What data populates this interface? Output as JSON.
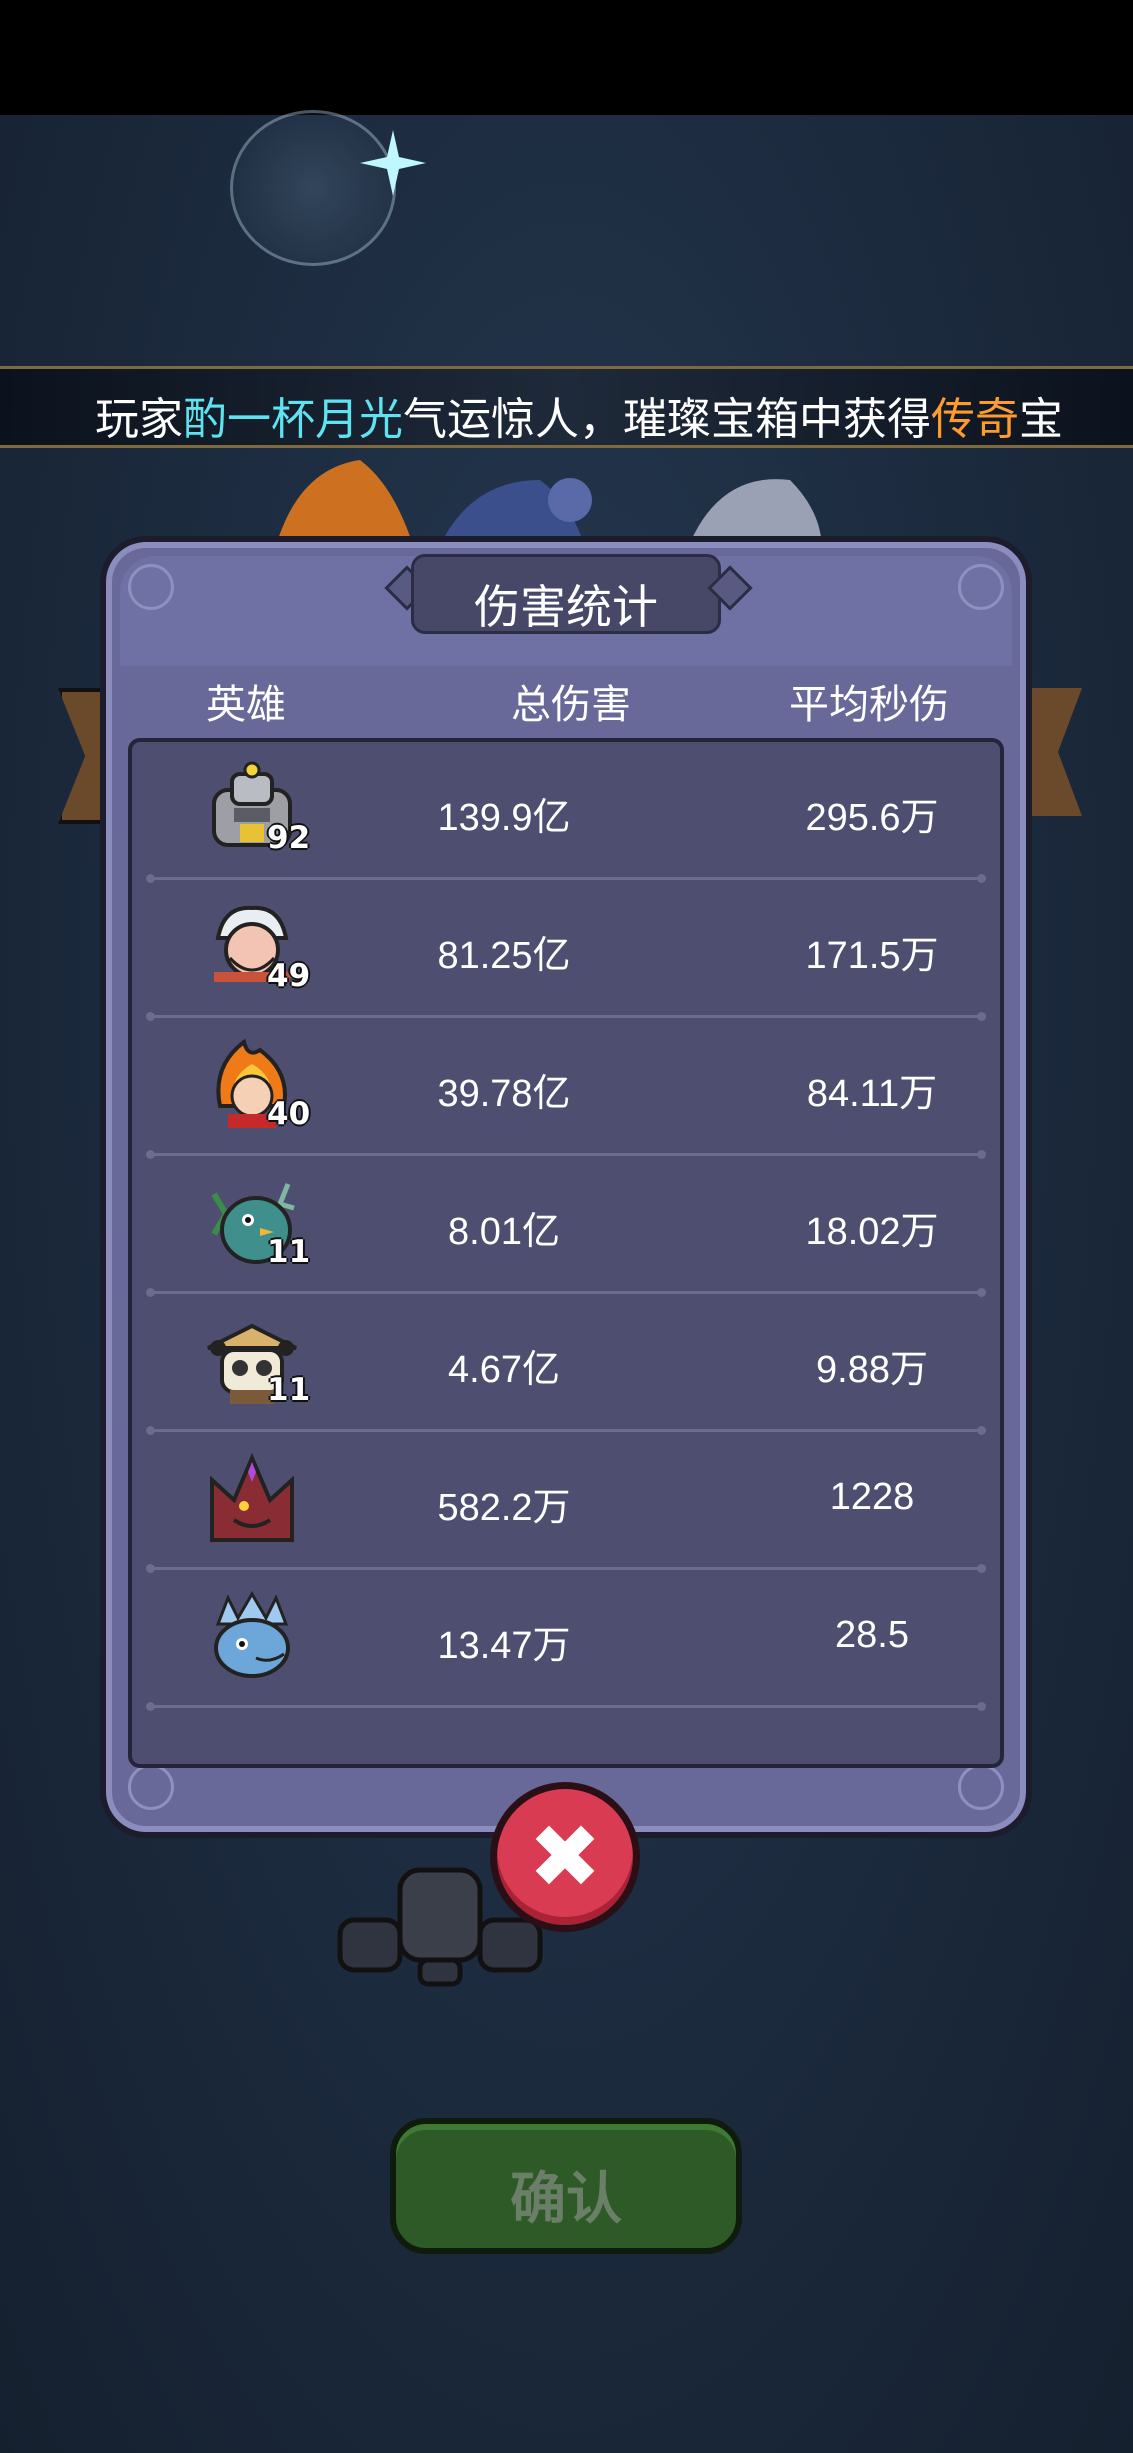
{
  "broadcast": {
    "prefix": "玩家",
    "player_name": "酌一杯月光",
    "middle": "气运惊人，璀璨宝箱中获得",
    "rarity": "传奇",
    "suffix": "宝"
  },
  "dialog": {
    "title": "伤害统计",
    "headers": {
      "hero": "英雄",
      "total": "总伤害",
      "dps": "平均秒伤"
    },
    "rows": [
      {
        "icon": "armored-knight-hero-icon",
        "level": "92",
        "total": "139.9亿",
        "dps": "295.6万"
      },
      {
        "icon": "white-haired-sage-hero-icon",
        "level": "49",
        "total": "81.25亿",
        "dps": "171.5万"
      },
      {
        "icon": "fire-spirit-hero-icon",
        "level": "40",
        "total": "39.78亿",
        "dps": "84.11万"
      },
      {
        "icon": "teal-forest-beast-hero-icon",
        "level": "11",
        "total": "8.01亿",
        "dps": "18.02万"
      },
      {
        "icon": "straw-hat-panda-hero-icon",
        "level": "11",
        "total": "4.67亿",
        "dps": "9.88万"
      },
      {
        "icon": "red-dragon-hero-icon",
        "level": "",
        "total": "582.2万",
        "dps": "1228"
      },
      {
        "icon": "ice-dragon-hero-icon",
        "level": "",
        "total": "13.47万",
        "dps": "28.5"
      }
    ]
  },
  "buttons": {
    "close_glyph": "✖",
    "confirm_label": "确认"
  },
  "colors": {
    "name_highlight": "#5fe3f0",
    "rarity_highlight": "#ff9b2e",
    "panel": "#686999",
    "close": "#d83b52",
    "confirm": "#2d5a26"
  }
}
